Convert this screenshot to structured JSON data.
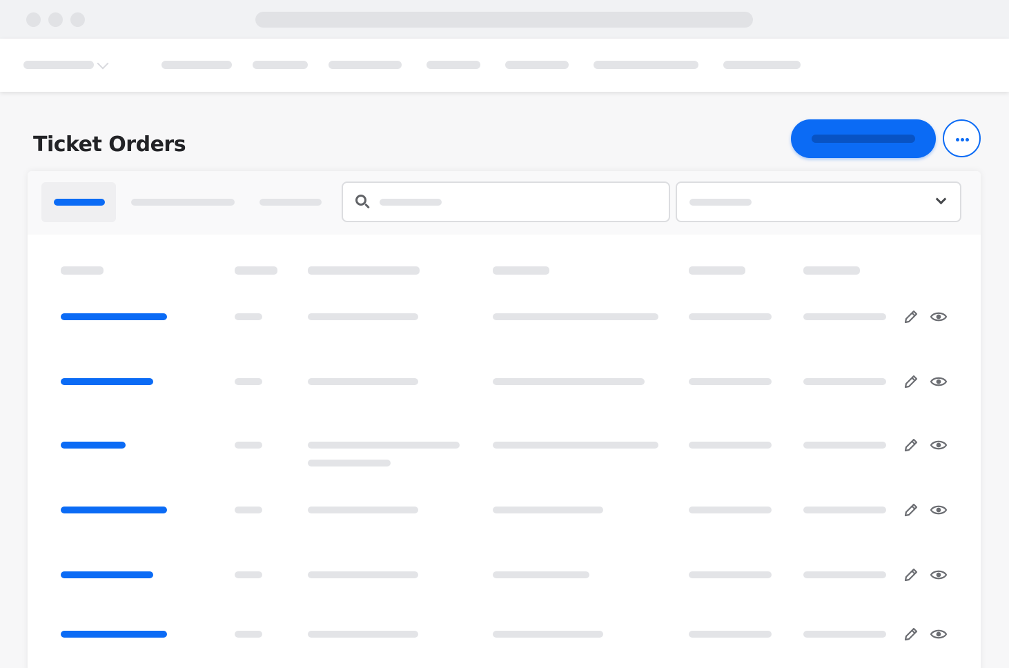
{
  "page": {
    "title": "Ticket Orders"
  },
  "colors": {
    "accent": "#0b6bf5",
    "placeholder": "#e3e4e7",
    "title": "#222326",
    "icon": "#6b6d72"
  },
  "icons": {
    "search": "search-icon",
    "dropdown": "chevron-down-icon",
    "more": "more-horizontal-icon",
    "edit": "pencil-icon",
    "view": "eye-icon"
  },
  "table": {
    "row_count": 6
  }
}
